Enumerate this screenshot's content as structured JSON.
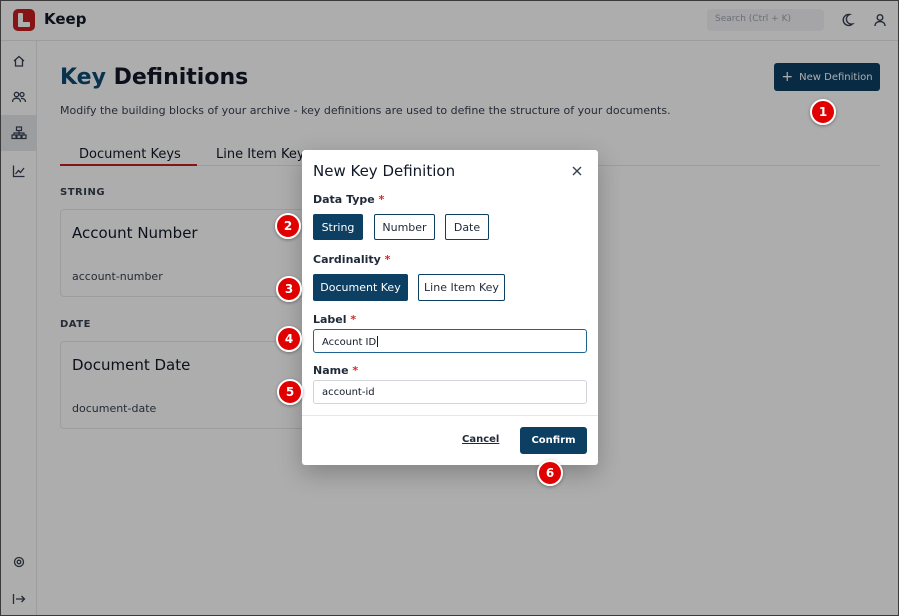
{
  "app": {
    "title": "Keep",
    "brand_color": "#c81e1e",
    "primary_color": "#0d3f63"
  },
  "topbar": {
    "search_placeholder": "Search (Ctrl + K)",
    "icons": [
      "moon-icon",
      "user-icon"
    ]
  },
  "sidebar": {
    "icons": [
      "home-icon",
      "users-icon",
      "sitemap-icon",
      "chart-icon",
      "settings-icon",
      "logout-icon"
    ]
  },
  "page": {
    "title_accent": "Key",
    "title_rest": " Definitions",
    "description": "Modify the building blocks of your archive - key definitions are used to define the structure of your documents.",
    "new_button": "New Definition",
    "new_button_icon": "plus-icon"
  },
  "tabs": [
    {
      "label": "Document Keys",
      "active": true
    },
    {
      "label": "Line Item Keys",
      "active": false
    }
  ],
  "sections": [
    {
      "label": "STRING",
      "cards": [
        {
          "title": "Account Number",
          "name": "account-number"
        }
      ]
    },
    {
      "label": "DATE",
      "cards": [
        {
          "title": "Document Date",
          "name": "document-date"
        }
      ]
    }
  ],
  "modal": {
    "title": "New Key Definition",
    "data_type": {
      "label": "Data Type",
      "required": "*",
      "options": [
        "String",
        "Number",
        "Date"
      ],
      "selected": "String"
    },
    "cardinality": {
      "label": "Cardinality",
      "required": "*",
      "options": [
        "Document Key",
        "Line Item Key"
      ],
      "selected": "Document Key"
    },
    "label_field": {
      "label": "Label",
      "required": "*",
      "value": "Account ID"
    },
    "name_field": {
      "label": "Name",
      "required": "*",
      "value": "account-id"
    },
    "cancel": "Cancel",
    "confirm": "Confirm"
  },
  "markers": [
    "1",
    "2",
    "3",
    "4",
    "5",
    "6"
  ]
}
